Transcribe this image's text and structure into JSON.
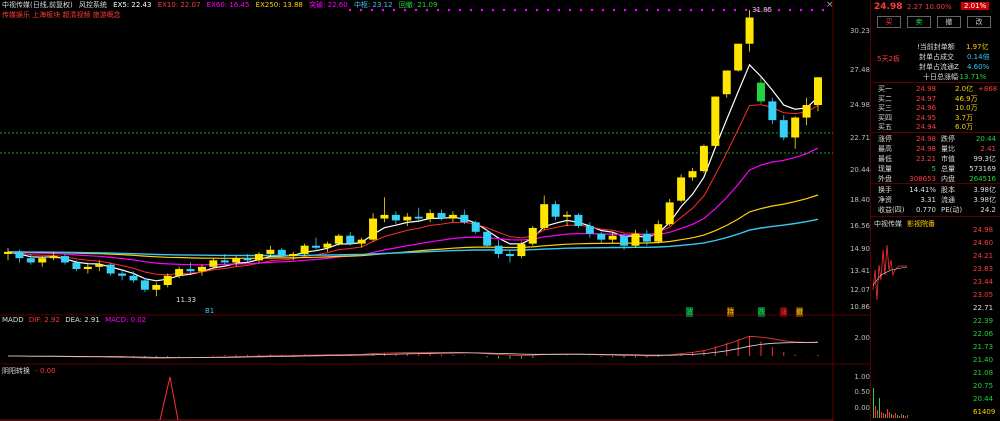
{
  "header": {
    "title": "中视传媒(日线,前复权)",
    "indicator": "风控系统",
    "ma": [
      {
        "label": "EX5: 22.43",
        "color": "#ffffff"
      },
      {
        "label": "EX10: 22.07",
        "color": "#ff3b3b"
      },
      {
        "label": "EX60: 16.45",
        "color": "#ff00ff"
      },
      {
        "label": "EX250: 13.88",
        "color": "#ffd000"
      },
      {
        "label": "突破: 22.60",
        "color": "#ff00ff"
      },
      {
        "label": "中枢: 23.12",
        "color": "#39c7f0"
      },
      {
        "label": "回撤: 21.09",
        "color": "#22d43e"
      }
    ],
    "tags": "传媒娱乐 上海板块 超清视频 旅游概念"
  },
  "chart_data": {
    "type": "candlestick",
    "price_axis_ticks": [
      "31.85",
      "30.23",
      "27.48",
      "24.98",
      "22.71",
      "20.44",
      "18.40",
      "16.56",
      "14.90",
      "13.41",
      "12.07",
      "10.86"
    ],
    "high_label": "31.85",
    "low_label": "11.33",
    "markers": [
      "B1",
      "波",
      "持",
      "跌",
      "涨",
      "撤"
    ],
    "candles_ohlc": [
      [
        13.2,
        13.5,
        12.9,
        13.3
      ],
      [
        13.3,
        13.4,
        12.8,
        13.0
      ],
      [
        13.0,
        13.2,
        12.7,
        12.8
      ],
      [
        12.8,
        13.1,
        12.6,
        13.0
      ],
      [
        13.0,
        13.3,
        12.9,
        13.1
      ],
      [
        13.1,
        13.2,
        12.7,
        12.8
      ],
      [
        12.8,
        12.9,
        12.4,
        12.5
      ],
      [
        12.5,
        12.8,
        12.3,
        12.6
      ],
      [
        12.6,
        12.9,
        12.4,
        12.7
      ],
      [
        12.7,
        12.8,
        12.2,
        12.3
      ],
      [
        12.3,
        12.5,
        12.0,
        12.2
      ],
      [
        12.2,
        12.4,
        11.9,
        12.0
      ],
      [
        12.0,
        12.1,
        11.5,
        11.6
      ],
      [
        11.6,
        11.9,
        11.33,
        11.8
      ],
      [
        11.8,
        12.3,
        11.7,
        12.2
      ],
      [
        12.2,
        12.6,
        12.1,
        12.5
      ],
      [
        12.5,
        12.8,
        12.3,
        12.4
      ],
      [
        12.4,
        12.7,
        12.2,
        12.6
      ],
      [
        12.6,
        13.0,
        12.5,
        12.9
      ],
      [
        12.9,
        13.2,
        12.7,
        12.8
      ],
      [
        12.8,
        13.1,
        12.6,
        13.0
      ],
      [
        13.0,
        13.2,
        12.8,
        12.9
      ],
      [
        12.9,
        13.3,
        12.8,
        13.2
      ],
      [
        13.2,
        13.6,
        13.1,
        13.4
      ],
      [
        13.4,
        13.5,
        13.0,
        13.1
      ],
      [
        13.1,
        13.3,
        12.9,
        13.2
      ],
      [
        13.2,
        13.7,
        13.1,
        13.6
      ],
      [
        13.6,
        14.0,
        13.4,
        13.5
      ],
      [
        13.5,
        13.8,
        13.3,
        13.7
      ],
      [
        13.7,
        14.2,
        13.6,
        14.1
      ],
      [
        14.1,
        14.3,
        13.6,
        13.7
      ],
      [
        13.7,
        14.0,
        13.5,
        13.9
      ],
      [
        13.9,
        15.3,
        13.8,
        15.0
      ],
      [
        15.0,
        16.2,
        14.8,
        15.2
      ],
      [
        15.2,
        15.4,
        14.7,
        14.9
      ],
      [
        14.9,
        15.3,
        14.6,
        15.1
      ],
      [
        15.1,
        15.6,
        14.9,
        15.0
      ],
      [
        15.0,
        15.5,
        14.8,
        15.3
      ],
      [
        15.3,
        15.5,
        14.9,
        15.0
      ],
      [
        15.0,
        15.4,
        14.8,
        15.2
      ],
      [
        15.2,
        15.5,
        14.7,
        14.8
      ],
      [
        14.8,
        14.9,
        14.2,
        14.3
      ],
      [
        14.3,
        14.4,
        13.5,
        13.6
      ],
      [
        13.6,
        13.9,
        13.0,
        13.2
      ],
      [
        13.2,
        13.4,
        12.8,
        13.1
      ],
      [
        13.1,
        13.8,
        13.0,
        13.7
      ],
      [
        13.7,
        14.6,
        13.6,
        14.5
      ],
      [
        14.5,
        16.3,
        14.4,
        15.8
      ],
      [
        15.8,
        16.0,
        14.9,
        15.1
      ],
      [
        15.1,
        15.4,
        14.6,
        15.2
      ],
      [
        15.2,
        15.3,
        14.5,
        14.6
      ],
      [
        14.6,
        14.8,
        14.0,
        14.2
      ],
      [
        14.2,
        14.3,
        13.7,
        13.9
      ],
      [
        13.9,
        14.3,
        13.7,
        14.1
      ],
      [
        14.1,
        14.2,
        13.4,
        13.6
      ],
      [
        13.6,
        14.4,
        13.5,
        14.2
      ],
      [
        14.2,
        14.4,
        13.6,
        13.8
      ],
      [
        13.8,
        14.9,
        13.7,
        14.7
      ],
      [
        14.7,
        16.1,
        14.6,
        15.9
      ],
      [
        16.0,
        17.6,
        15.9,
        17.4
      ],
      [
        17.4,
        18.0,
        17.2,
        17.8
      ],
      [
        17.8,
        19.6,
        17.7,
        19.5
      ],
      [
        19.5,
        23.3,
        19.4,
        23.3
      ],
      [
        23.5,
        25.6,
        23.2,
        25.6
      ],
      [
        25.6,
        28.2,
        25.5,
        28.2
      ],
      [
        28.2,
        31.85,
        27.4,
        31.0
      ],
      [
        24.5,
        25.0,
        22.7,
        22.9
      ],
      [
        22.9,
        23.2,
        21.1,
        21.4
      ],
      [
        21.4,
        21.8,
        19.9,
        20.1
      ],
      [
        20.1,
        21.7,
        19.3,
        21.6
      ],
      [
        21.6,
        23.2,
        21.0,
        22.6
      ],
      [
        22.6,
        25.0,
        22.1,
        24.98
      ]
    ]
  },
  "macd": {
    "label": "MADD",
    "dif": "DIF: 2.92",
    "dea": "DEA: 2.91",
    "macd": "MACD: 0.02",
    "axis": [
      "2.00"
    ]
  },
  "indicator3": {
    "label": "阴阳转换",
    "value": "- 0.00",
    "axis": [
      "1.00",
      "0.50",
      "0.00"
    ]
  },
  "panel": {
    "price": "24.98",
    "change": "2.27",
    "pct": "10.00%",
    "top_tag": "2.01%",
    "buttons": [
      "买",
      "卖",
      "撤",
      "改"
    ],
    "stats": [
      {
        "k": "!当前封单额",
        "v": "1.97亿"
      },
      {
        "k": "封单占成交",
        "v": "0.14倍"
      },
      {
        "k": "封单占流通Z",
        "v": "4.60%"
      },
      {
        "k": "十日总涨幅",
        "v": "-13.71%"
      }
    ],
    "limit_tag": "5天2板",
    "order_book": [
      {
        "name": "买一",
        "price": "24.98",
        "vol": "2.0亿",
        "extra": "+868"
      },
      {
        "name": "买二",
        "price": "24.97",
        "vol": "46.9万",
        "extra": ""
      },
      {
        "name": "买三",
        "price": "24.96",
        "vol": "10.0万",
        "extra": ""
      },
      {
        "name": "买四",
        "price": "24.95",
        "vol": "3.7万",
        "extra": ""
      },
      {
        "name": "买五",
        "price": "24.94",
        "vol": "6.0万",
        "extra": ""
      }
    ],
    "quotes": [
      {
        "k1": "涨停",
        "v1": "24.98",
        "k2": "跌停",
        "v2": "20.44"
      },
      {
        "k1": "最高",
        "v1": "24.98",
        "k2": "量比",
        "v2": "2.41"
      },
      {
        "k1": "最低",
        "v1": "23.21",
        "k2": "市值",
        "v2": "99.3亿"
      },
      {
        "k1": "现量",
        "v1": "5",
        "k2": "总量",
        "v2": "573169"
      },
      {
        "k1": "外盘",
        "v1": "308653",
        "k2": "内盘",
        "v2": "264516"
      }
    ],
    "fundamentals": [
      {
        "k1": "换手",
        "v1": "14.41%",
        "k2": "股本",
        "v2": "3.98亿"
      },
      {
        "k1": "净资",
        "v1": "3.31",
        "k2": "流通",
        "v2": "3.98亿"
      },
      {
        "k1": "收益(四)",
        "v1": "0.770",
        "k2": "PE(动)",
        "v2": "24.2"
      }
    ],
    "tabs": [
      "中视传媒",
      "影视院番"
    ],
    "mini_axis": [
      "24.98",
      "24.60",
      "24.21",
      "23.83",
      "23.44",
      "23.05",
      "22.71",
      "22.39",
      "22.06",
      "21.73",
      "21.40",
      "21.08",
      "20.75",
      "20.44",
      "61409"
    ]
  }
}
